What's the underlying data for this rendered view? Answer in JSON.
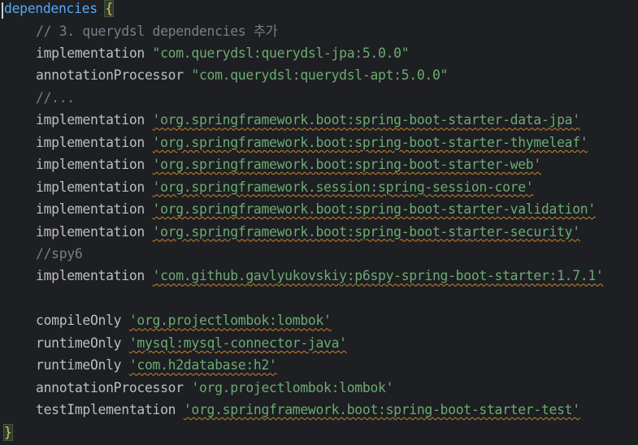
{
  "editor": {
    "header": {
      "name": "dependencies",
      "brace": "{"
    },
    "lines": [
      {
        "type": "comment",
        "text": "// 3. querydsl dependencies 추가"
      },
      {
        "type": "dep",
        "config": "implementation",
        "value": "\"com.querydsl:querydsl-jpa:5.0.0\"",
        "warn": false
      },
      {
        "type": "dep",
        "config": "annotationProcessor",
        "value": "\"com.querydsl:querydsl-apt:5.0.0\"",
        "warn": false
      },
      {
        "type": "comment",
        "text": "//..."
      },
      {
        "type": "dep",
        "config": "implementation",
        "value": "'org.springframework.boot:spring-boot-starter-data-jpa'",
        "warn": true
      },
      {
        "type": "dep",
        "config": "implementation",
        "value": "'org.springframework.boot:spring-boot-starter-thymeleaf'",
        "warn": true
      },
      {
        "type": "dep",
        "config": "implementation",
        "value": "'org.springframework.boot:spring-boot-starter-web'",
        "warn": true
      },
      {
        "type": "dep",
        "config": "implementation",
        "value": "'org.springframework.session:spring-session-core'",
        "warn": true
      },
      {
        "type": "dep",
        "config": "implementation",
        "value": "'org.springframework.boot:spring-boot-starter-validation'",
        "warn": true
      },
      {
        "type": "dep",
        "config": "implementation",
        "value": "'org.springframework.boot:spring-boot-starter-security'",
        "warn": true
      },
      {
        "type": "comment",
        "text": "//spy6"
      },
      {
        "type": "dep",
        "config": "implementation",
        "value": "'com.github.gavlyukovskiy:p6spy-spring-boot-starter:1.7.1'",
        "warn": true
      },
      {
        "type": "blank"
      },
      {
        "type": "dep",
        "config": "compileOnly",
        "value": "'org.projectlombok:lombok'",
        "warn": true
      },
      {
        "type": "dep",
        "config": "runtimeOnly",
        "value": "'mysql:mysql-connector-java'",
        "warn": true
      },
      {
        "type": "dep",
        "config": "runtimeOnly",
        "value": "'com.h2database:h2'",
        "warn": true
      },
      {
        "type": "dep",
        "config": "annotationProcessor",
        "value": "'org.projectlombok:lombok'",
        "warn": false
      },
      {
        "type": "dep",
        "config": "testImplementation",
        "value": "'org.springframework.boot:spring-boot-starter-test'",
        "warn": true
      }
    ],
    "footer": {
      "brace": "}"
    }
  }
}
